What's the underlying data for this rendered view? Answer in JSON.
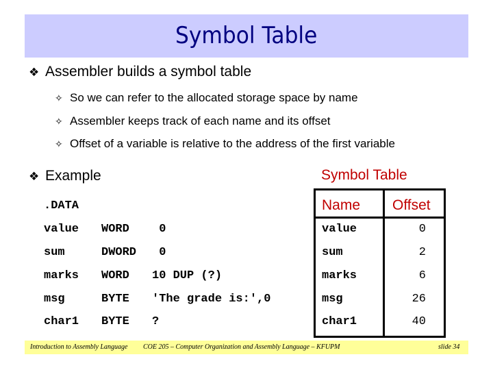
{
  "slide": {
    "title": "Symbol Table",
    "bullets": [
      {
        "icon": "four-diamond-bullet",
        "glyph": "❖",
        "text": "Assembler builds a symbol table",
        "sub": [
          {
            "icon": "four-point-star-bullet",
            "glyph": "✧",
            "text": "So we can refer to the allocated storage space by name"
          },
          {
            "icon": "four-point-star-bullet",
            "glyph": "✧",
            "text": "Assembler keeps track of each name and its offset"
          },
          {
            "icon": "four-point-star-bullet",
            "glyph": "✧",
            "text": "Offset of a variable is relative to the address of the first variable"
          }
        ]
      },
      {
        "icon": "four-diamond-bullet",
        "glyph": "❖",
        "text": "Example"
      }
    ],
    "code": {
      "directive": ".DATA",
      "rows": [
        {
          "name": "value",
          "type": "WORD",
          "init": " 0"
        },
        {
          "name": "sum",
          "type": "DWORD",
          "init": " 0"
        },
        {
          "name": "marks",
          "type": "WORD",
          "init": "10 DUP (?)"
        },
        {
          "name": "msg",
          "type": "BYTE",
          "init": "'The grade is:',0"
        },
        {
          "name": "char1",
          "type": "BYTE",
          "init": "?"
        }
      ]
    },
    "symbol_table": {
      "caption": "Symbol Table",
      "headers": {
        "name": "Name",
        "offset": "Offset"
      },
      "rows": [
        {
          "name": "value",
          "offset": "0"
        },
        {
          "name": "sum",
          "offset": "2"
        },
        {
          "name": "marks",
          "offset": "6"
        },
        {
          "name": "msg",
          "offset": "26"
        },
        {
          "name": "char1",
          "offset": "40"
        }
      ]
    },
    "footer": {
      "left": "Introduction to Assembly Language",
      "center": "COE 205 – Computer Organization and Assembly Language – KFUPM",
      "right": "slide 34"
    },
    "colors": {
      "title_bar": "#ccccff",
      "title_text": "#000080",
      "table_header_text": "#c00000",
      "footer_bar": "#ffff99"
    }
  }
}
